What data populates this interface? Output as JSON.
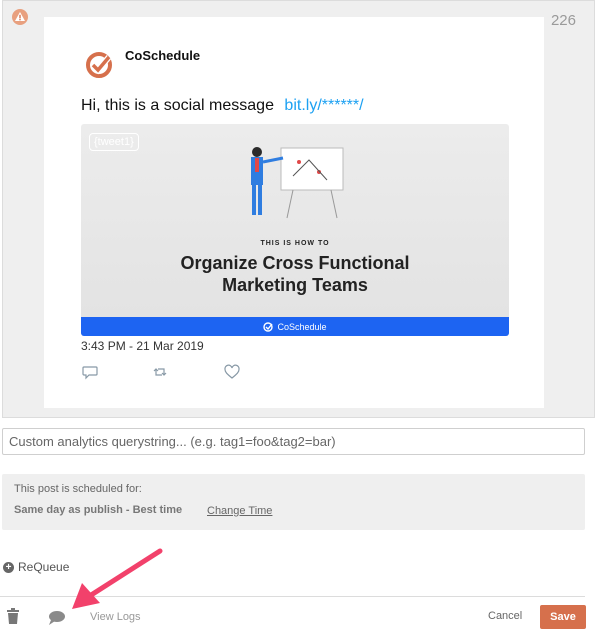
{
  "preview": {
    "char_count": "226",
    "brand_name": "CoSchedule",
    "message_text": "Hi, this is a social message",
    "message_link": "bit.ly/******/",
    "media": {
      "tag": "{tweet1}",
      "kicker": "THIS IS HOW TO",
      "headline_line1": "Organize Cross Functional",
      "headline_line2": "Marketing Teams",
      "footer_brand": "CoSchedule"
    },
    "timestamp": "3:43 PM - 21 Mar 2019",
    "icons": [
      "reply-icon",
      "retweet-icon",
      "like-icon"
    ]
  },
  "querystring": {
    "placeholder": "Custom analytics querystring... (e.g. tag1=foo&tag2=bar)",
    "value": ""
  },
  "schedule": {
    "label": "This post is scheduled for:",
    "value": "Same day as publish - Best time",
    "change_link": "Change Time"
  },
  "requeue_label": "ReQueue",
  "footer": {
    "view_logs": "View Logs",
    "cancel": "Cancel",
    "save": "Save"
  },
  "colors": {
    "accent_save": "#d6704c",
    "link": "#1da1f2",
    "annotation_arrow": "#f2416b",
    "media_footer": "#1d64f2"
  }
}
